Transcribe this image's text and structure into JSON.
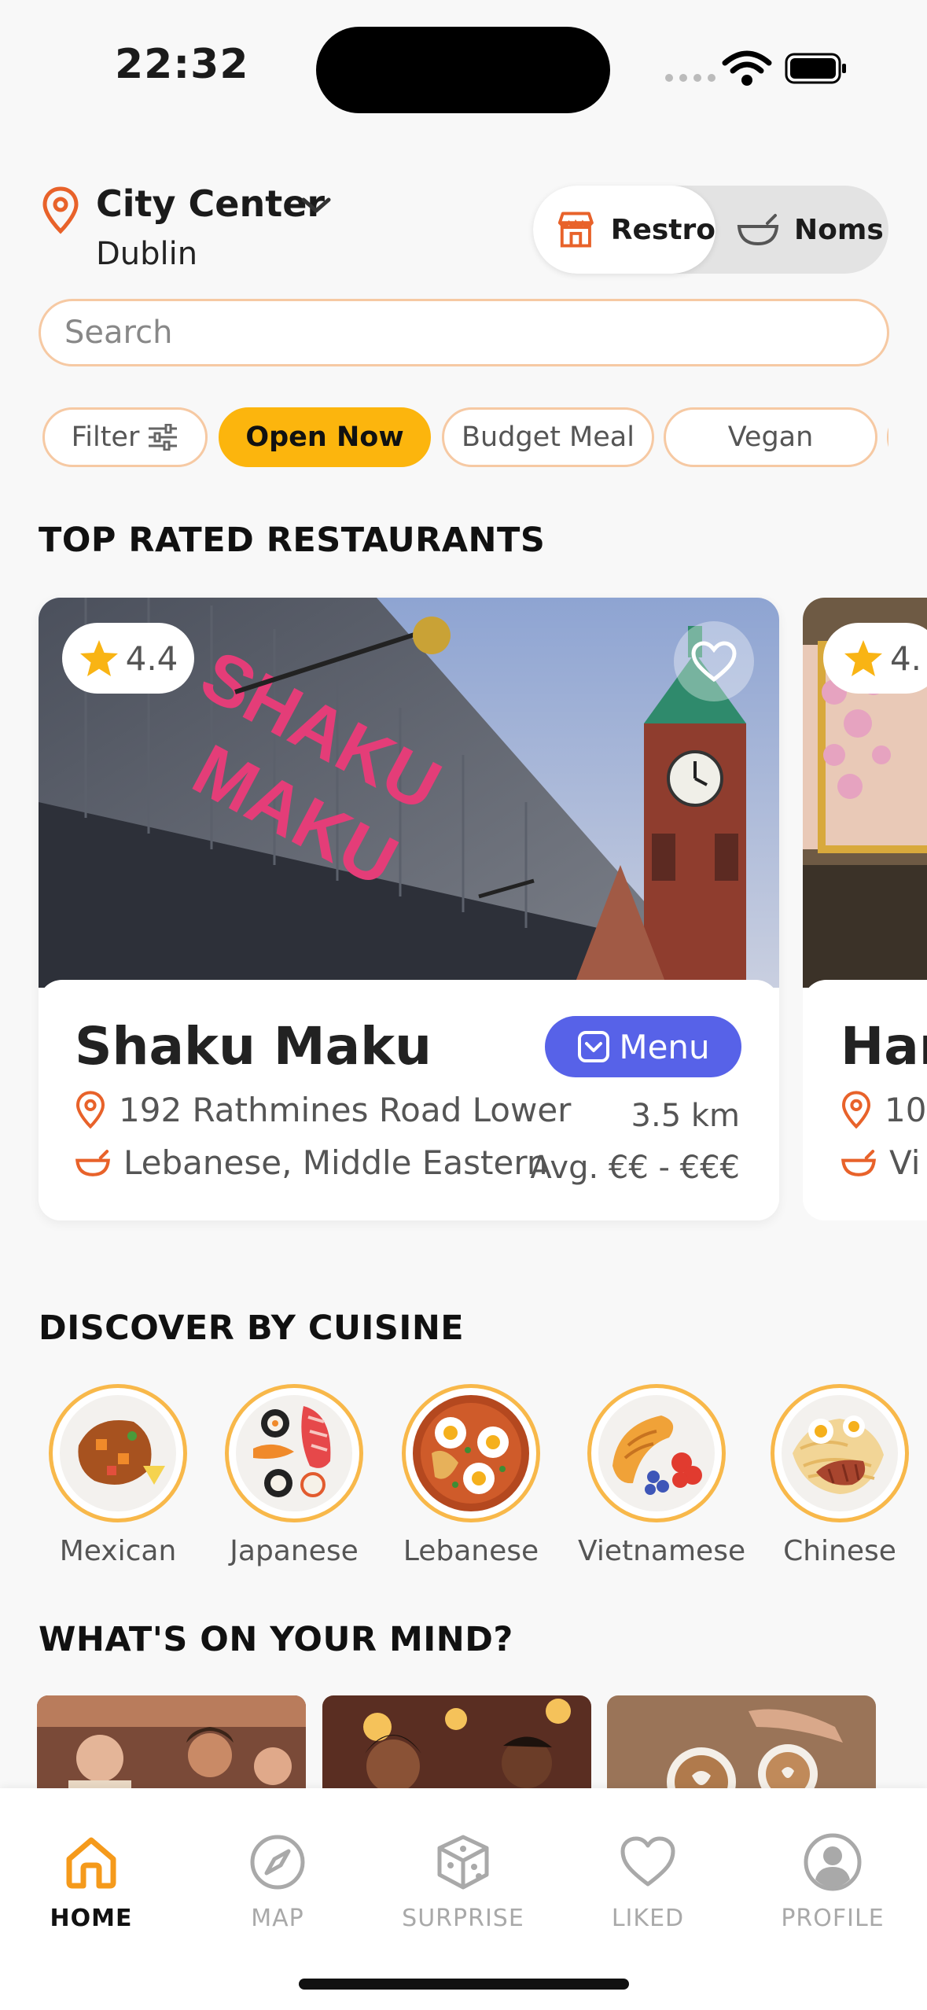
{
  "status_bar": {
    "time": "22:32"
  },
  "location": {
    "area": "City Center",
    "city": "Dublin"
  },
  "mode_toggle": {
    "active": "Restro",
    "inactive": "Noms"
  },
  "search": {
    "placeholder": "Search"
  },
  "chips": [
    {
      "label": "Filter",
      "active": false
    },
    {
      "label": "Open Now",
      "active": true
    },
    {
      "label": "Budget Meal",
      "active": false
    },
    {
      "label": "Vegan",
      "active": false
    }
  ],
  "sections": {
    "top_rated": "TOP RATED RESTAURANTS",
    "discover": "DISCOVER BY CUISINE",
    "mind": "WHAT'S ON YOUR MIND?"
  },
  "restaurants": [
    {
      "rating": "4.4",
      "name": "Shaku Maku",
      "menu_label": "Menu",
      "address": "192 Rathmines Road Lower",
      "distance": "3.5 km",
      "cuisine": "Lebanese, Middle Eastern",
      "price": "Avg. €€ - €€€",
      "sign_text": "SHAKU MAKU"
    },
    {
      "rating": "4.",
      "name": "Har",
      "address": "10",
      "cuisine": "Vi"
    }
  ],
  "cuisines": [
    {
      "label": "Mexican"
    },
    {
      "label": "Japanese"
    },
    {
      "label": "Lebanese"
    },
    {
      "label": "Vietnamese"
    },
    {
      "label": "Chinese"
    }
  ],
  "tabs": [
    {
      "label": "HOME",
      "icon": "home-icon",
      "active": true
    },
    {
      "label": "MAP",
      "icon": "compass-icon",
      "active": false
    },
    {
      "label": "SURPRISE",
      "icon": "dice-icon",
      "active": false
    },
    {
      "label": "LIKED",
      "icon": "heart-icon",
      "active": false
    },
    {
      "label": "PROFILE",
      "icon": "profile-icon",
      "active": false
    }
  ],
  "colors": {
    "accent_orange": "#e8622a",
    "chip_yellow": "#fcb50d",
    "menu_blue": "#5762e8",
    "home_orange": "#f59a1b"
  }
}
